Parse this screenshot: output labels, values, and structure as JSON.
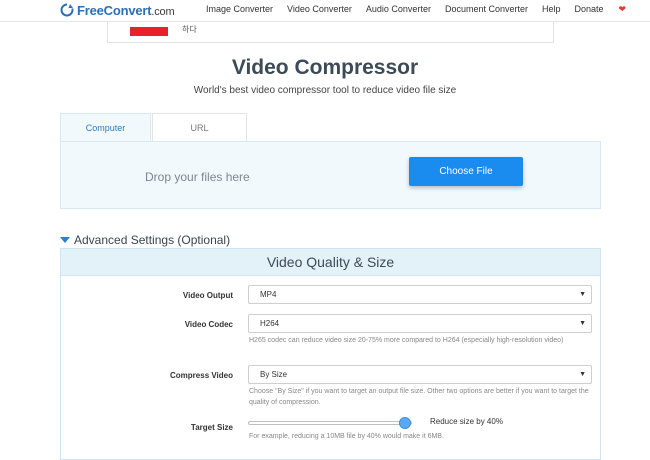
{
  "header": {
    "logo_name": "FreeConvert",
    "logo_tld": ".com",
    "nav": [
      "Image Converter",
      "Video Converter",
      "Audio Converter",
      "Document Converter",
      "Help",
      "Donate"
    ]
  },
  "ad": {
    "text": "하다"
  },
  "page": {
    "title": "Video Compressor",
    "subtitle": "World's best video compressor tool to reduce video file size"
  },
  "upload": {
    "tabs": [
      "Computer",
      "URL"
    ],
    "active_tab": "Computer",
    "drop_text": "Drop your files here",
    "choose_label": "Choose File"
  },
  "advanced": {
    "toggle_label": "Advanced Settings (Optional)",
    "panel_title": "Video Quality & Size",
    "video_output": {
      "label": "Video Output",
      "value": "MP4"
    },
    "video_codec": {
      "label": "Video Codec",
      "value": "H264",
      "help": "H265 codec can reduce video size 20-75% more compared to H264 (especially high-resolution video)"
    },
    "compress_video": {
      "label": "Compress Video",
      "value": "By Size",
      "help": "Choose \"By Size\" if you want to target an output file size. Other two options are better if you want to target the quality of compression."
    },
    "target_size": {
      "label": "Target Size",
      "percent": 40,
      "value_text": "Reduce size by 40%",
      "help": "For example, reducing a 10MB file by 40% would make it 6MB."
    }
  },
  "colors": {
    "accent": "#1a8cf0",
    "panel_bg": "#e3f1f9",
    "logo": "#2c6fb8"
  }
}
